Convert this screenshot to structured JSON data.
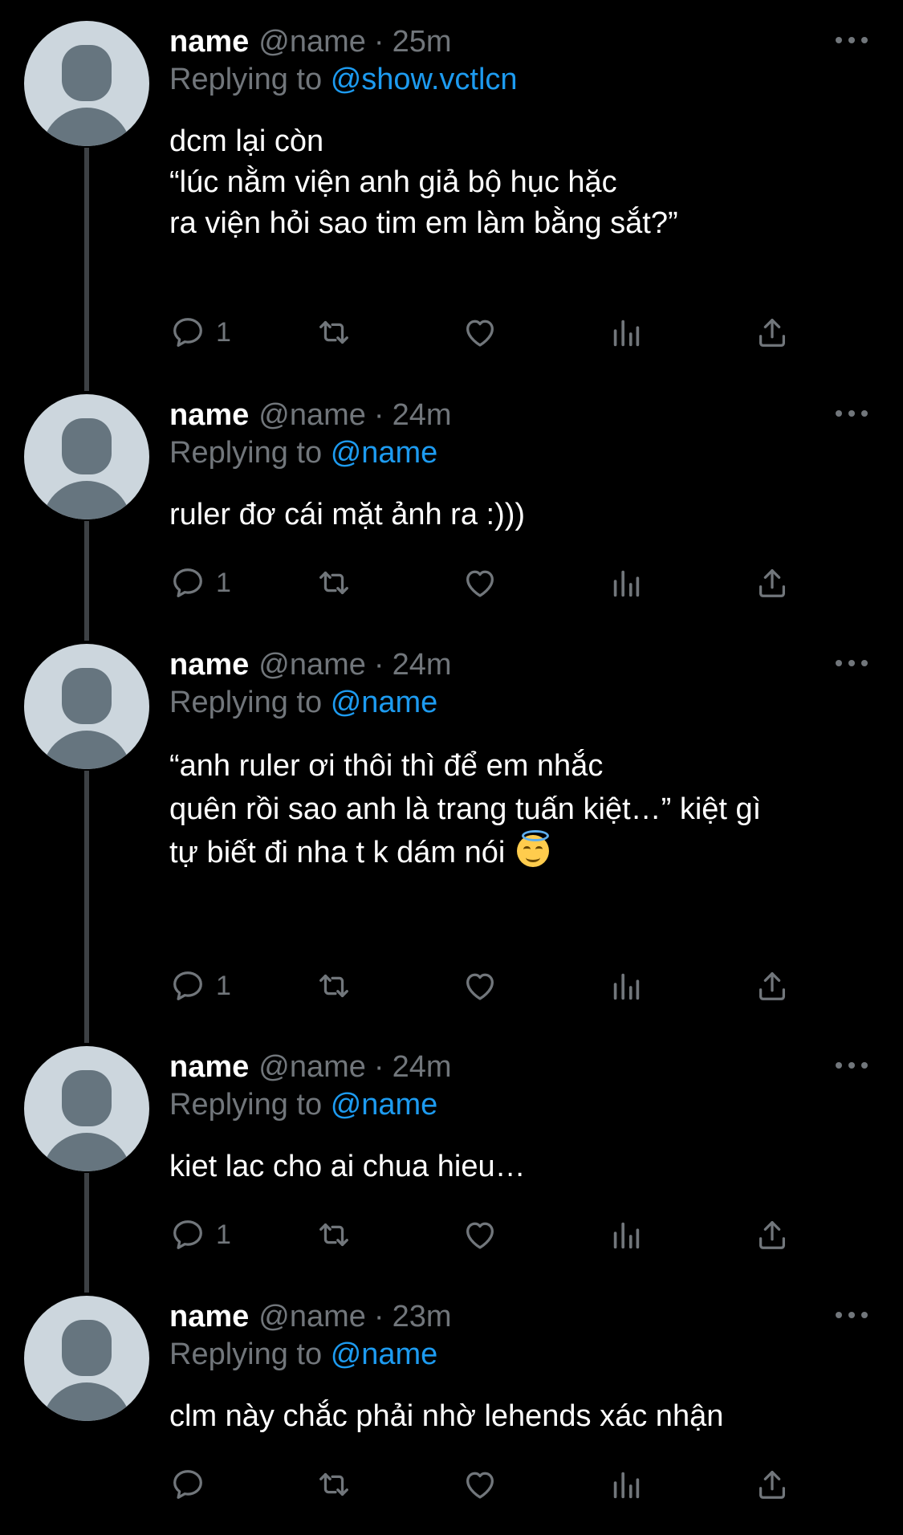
{
  "colors": {
    "background": "#000000",
    "text_primary": "#ffffff",
    "text_secondary": "#71767b",
    "mention": "#1d9bf0",
    "thread_line": "#3d4145",
    "avatar_bg": "#ccd6dd",
    "avatar_fg": "#66757f"
  },
  "icons": {
    "reply": "speech-bubble-icon",
    "retweet": "retweet-arrows-icon",
    "like": "heart-icon",
    "views": "bar-chart-icon",
    "share": "share-upload-icon",
    "more": "more-dots-icon",
    "emoji": "smiling-face-with-halo-emoji"
  },
  "tweets": [
    {
      "display_name": "name",
      "handle": "@name",
      "separator": "·",
      "time": "25m",
      "replying_prefix": "Replying to",
      "replying_to": "@show.vctlcn",
      "body_lines": [
        "dcm lại còn",
        "“lúc nằm viện anh giả bộ hục hặc",
        "ra viện hỏi sao tim em làm bằng sắt?”"
      ],
      "reply_count": "1"
    },
    {
      "display_name": "name",
      "handle": "@name",
      "separator": "·",
      "time": "24m",
      "replying_prefix": "Replying to",
      "replying_to": "@name",
      "body_lines": [
        "ruler đơ cái mặt ảnh ra :)))"
      ],
      "reply_count": "1"
    },
    {
      "display_name": "name",
      "handle": "@name",
      "separator": "·",
      "time": "24m",
      "replying_prefix": "Replying to",
      "replying_to": "@name",
      "body_lines": [
        "“anh ruler ơi thôi thì để em nhắc",
        "quên rồi sao anh là trang tuấn kiệt…” kiệt gì",
        "tự biết đi nha t k dám nói"
      ],
      "reply_count": "1"
    },
    {
      "display_name": "name",
      "handle": "@name",
      "separator": "·",
      "time": "24m",
      "replying_prefix": "Replying to",
      "replying_to": "@name",
      "body_lines": [
        "kiet lac cho ai chua hieu…"
      ],
      "reply_count": "1"
    },
    {
      "display_name": "name",
      "handle": "@name",
      "separator": "·",
      "time": "23m",
      "replying_prefix": "Replying to",
      "replying_to": "@name",
      "body_lines": [
        "clm này chắc phải nhờ lehends xác nhận"
      ],
      "reply_count": ""
    }
  ]
}
